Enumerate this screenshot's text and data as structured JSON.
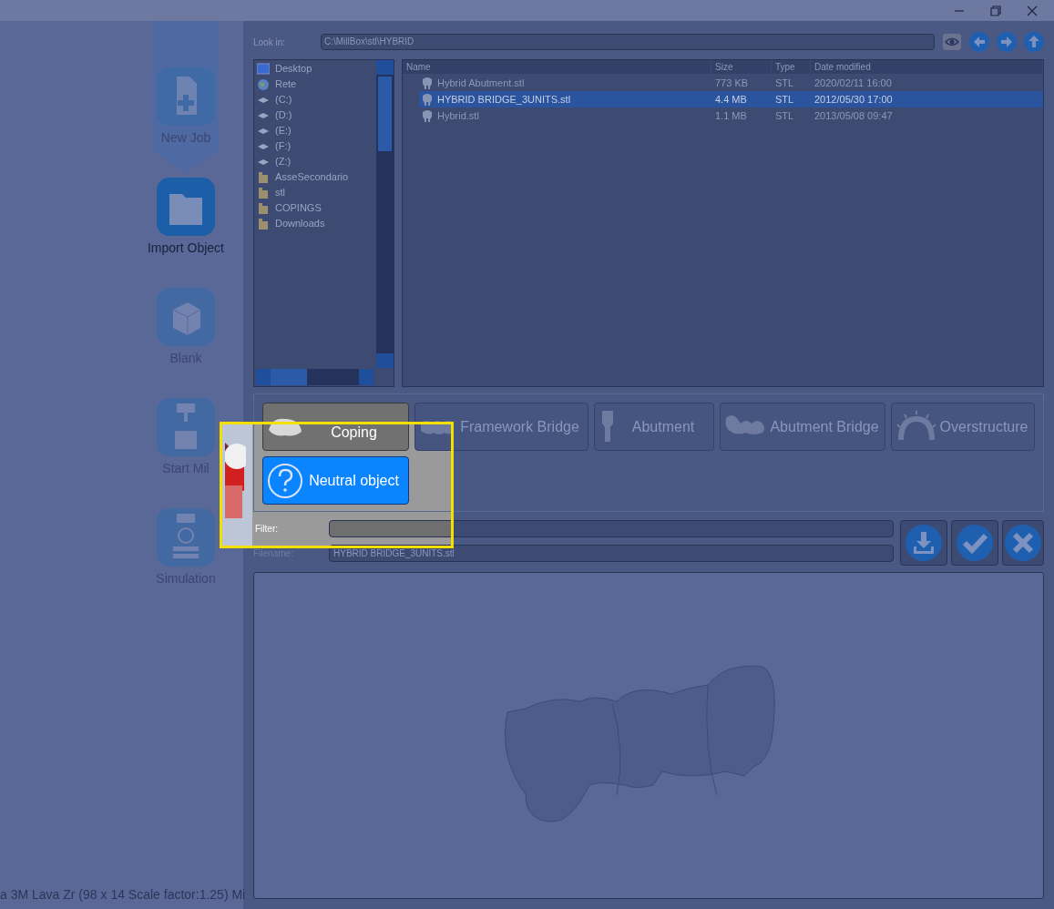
{
  "sidebar": {
    "items": [
      {
        "label": "New Job",
        "selected": false
      },
      {
        "label": "Import Object",
        "selected": true
      },
      {
        "label": "Blank",
        "selected": false
      },
      {
        "label": "Start Mil",
        "selected": false
      },
      {
        "label": "Simulation",
        "selected": false
      }
    ]
  },
  "status_text": "a 3M Lava Zr (98 x 14 Scale factor:1.25) Mi",
  "look_in": {
    "label": "Look in:",
    "value": "C:\\MillBox\\stl\\HYBRID"
  },
  "tree": {
    "items": [
      {
        "label": "Desktop",
        "kind": "desktop"
      },
      {
        "label": "Rete",
        "kind": "network"
      },
      {
        "label": "(C:)",
        "kind": "drive"
      },
      {
        "label": "(D:)",
        "kind": "drive"
      },
      {
        "label": "(E:)",
        "kind": "drive"
      },
      {
        "label": "(F:)",
        "kind": "drive"
      },
      {
        "label": "(Z:)",
        "kind": "drive"
      },
      {
        "label": "AsseSecondario",
        "kind": "folder"
      },
      {
        "label": "stl",
        "kind": "folder"
      },
      {
        "label": "COPINGS",
        "kind": "folder"
      },
      {
        "label": "Downloads",
        "kind": "folder"
      }
    ]
  },
  "file_list": {
    "columns": [
      "Name",
      "Size",
      "Type",
      "Date modified"
    ],
    "rows": [
      {
        "cells": [
          "Hybrid Abutment.stl",
          "773 KB",
          "STL",
          "2020/02/11 16:00"
        ],
        "selected": false
      },
      {
        "cells": [
          "HYBRID BRIDGE_3UNITS.stl",
          "4.4 MB",
          "STL",
          "2012/05/30 17:00"
        ],
        "selected": true
      },
      {
        "cells": [
          "Hybrid.stl",
          "1.1 MB",
          "STL",
          "2013/05/08 09:47"
        ],
        "selected": false
      }
    ]
  },
  "object_types": [
    {
      "label": "Coping",
      "kind": "coping",
      "selected": false
    },
    {
      "label": "Framework Bridge",
      "kind": "bridge",
      "selected": false
    },
    {
      "label": "Abutment",
      "kind": "abutment",
      "selected": false
    },
    {
      "label": "Abutment Bridge",
      "kind": "abutment_bridge",
      "selected": false
    },
    {
      "label": "Overstructure",
      "kind": "overstructure",
      "selected": false
    },
    {
      "label": "Neutral object",
      "kind": "neutral",
      "selected": true
    }
  ],
  "filter": {
    "label": "Filter:"
  },
  "filename": {
    "label": "Filename:",
    "value": "HYBRID BRIDGE_3UNITS.stl"
  }
}
